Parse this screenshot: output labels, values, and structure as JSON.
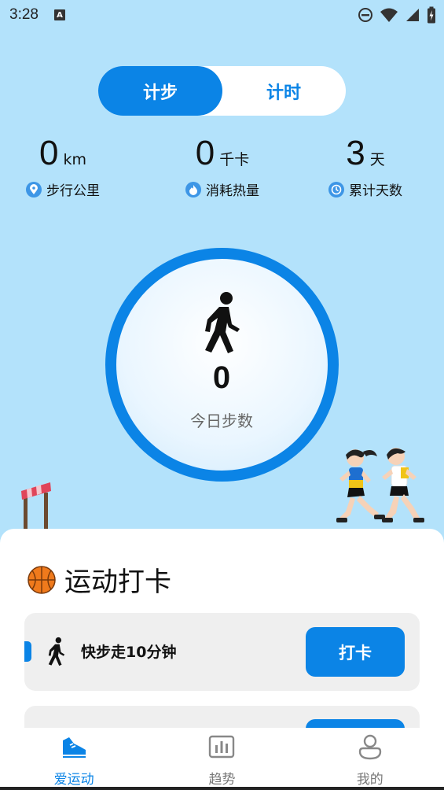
{
  "status_bar": {
    "time": "3:28",
    "notification_icon": "A",
    "icons": [
      "dnd-icon",
      "wifi-icon",
      "signal-icon",
      "battery-charging-icon"
    ]
  },
  "mode_toggle": {
    "options": [
      {
        "label": "计步",
        "selected": true
      },
      {
        "label": "计时",
        "selected": false
      }
    ]
  },
  "stats": [
    {
      "value": "0",
      "unit": "km",
      "label": "步行公里",
      "icon": "location-pin-icon"
    },
    {
      "value": "0",
      "unit": "千卡",
      "label": "消耗热量",
      "icon": "flame-icon"
    },
    {
      "value": "3",
      "unit": "天",
      "label": "累计天数",
      "icon": "clock-icon"
    }
  ],
  "today": {
    "steps": "0",
    "label": "今日步数",
    "icon": "walking-person-icon"
  },
  "checkin": {
    "title": "运动打卡",
    "icon": "basketball-icon",
    "tasks": [
      {
        "label": "快步走10分钟",
        "button": "打卡",
        "icon": "walking-person-icon"
      },
      {
        "label": "",
        "button": "",
        "icon": ""
      }
    ]
  },
  "bottom_nav": {
    "items": [
      {
        "label": "爱运动",
        "icon": "sneaker-icon",
        "active": true
      },
      {
        "label": "趋势",
        "icon": "bar-chart-icon",
        "active": false
      },
      {
        "label": "我的",
        "icon": "user-icon",
        "active": false
      }
    ]
  },
  "colors": {
    "accent": "#0b84e6",
    "background": "#b3e2fb",
    "card": "#efefef"
  }
}
